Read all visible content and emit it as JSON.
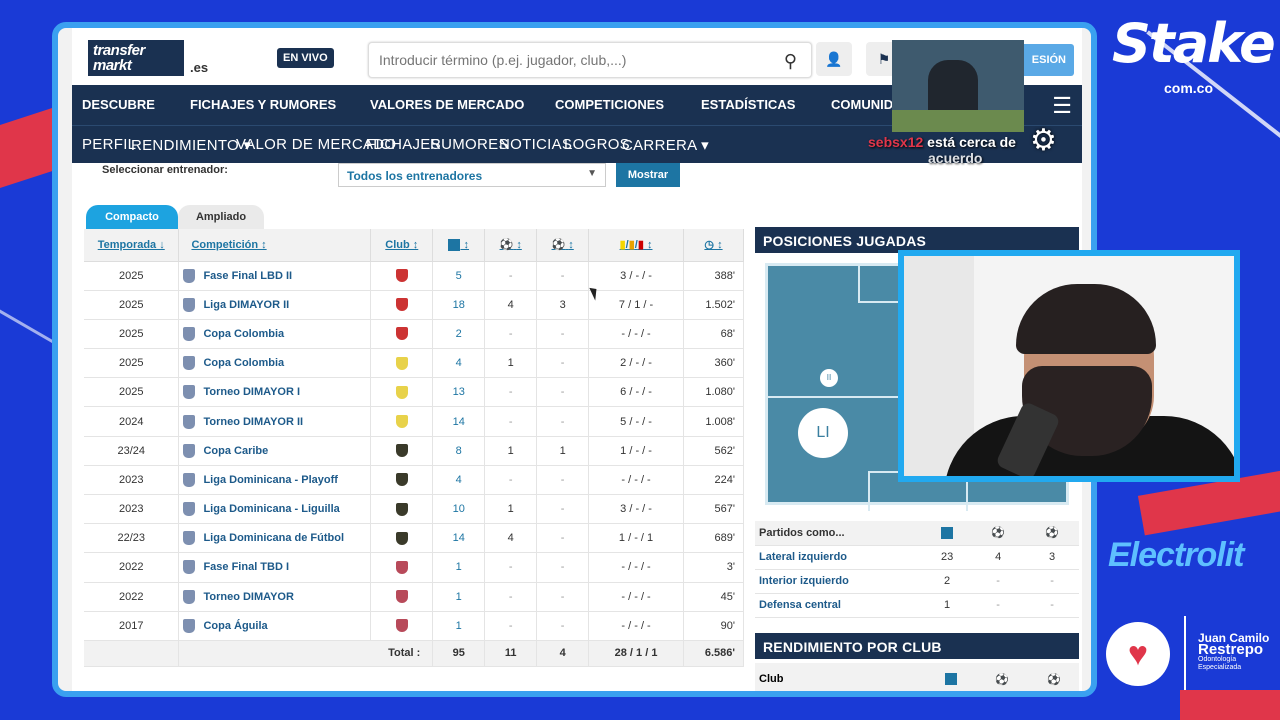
{
  "header": {
    "logo_text": "transfer markt",
    "logo_domain": ".es",
    "live_badge": "EN VIVO",
    "search_placeholder": "Introducir término (p.ej. jugador, club,...)",
    "login_label": "ESIÓN"
  },
  "nav_main": [
    "DESCUBRE",
    "FICHAJES Y RUMORES",
    "VALORES DE MERCADO",
    "COMPETICIONES",
    "ESTADÍSTICAS",
    "COMUNID"
  ],
  "nav_sub": [
    "PERFIL",
    "RENDIMIENTO ▾",
    "VALOR DE MERCADO",
    "FICHAJES",
    "RUMORES",
    "NOTICIAS",
    "LOGROS",
    "CARRERA ▾"
  ],
  "filter": {
    "label": "Seleccionar entrenador:",
    "value": "Todos los entrenadores",
    "button": "Mostrar"
  },
  "tabs": [
    "Compacto",
    "Ampliado"
  ],
  "table": {
    "headers": {
      "season": "Temporada ↓",
      "competition": "Competición ↕",
      "club": "Club ↕",
      "apps": "↕",
      "goals": "↕",
      "assists": "↕",
      "cards": "↕",
      "minutes": ""
    },
    "rows": [
      {
        "season": "2025",
        "competition": "Fase Final LBD II",
        "apps": "5",
        "goals": "-",
        "assists": "-",
        "cards": "3 / - / -",
        "minutes": "388'"
      },
      {
        "season": "2025",
        "competition": "Liga DIMAYOR II",
        "apps": "18",
        "goals": "4",
        "assists": "3",
        "cards": "7 / 1 / -",
        "minutes": "1.502'"
      },
      {
        "season": "2025",
        "competition": "Copa Colombia",
        "apps": "2",
        "goals": "-",
        "assists": "-",
        "cards": "- / - / -",
        "minutes": "68'"
      },
      {
        "season": "2025",
        "competition": "Copa Colombia",
        "apps": "4",
        "goals": "1",
        "assists": "-",
        "cards": "2 / - / -",
        "minutes": "360'"
      },
      {
        "season": "2025",
        "competition": "Torneo DIMAYOR I",
        "apps": "13",
        "goals": "-",
        "assists": "-",
        "cards": "6 / - / -",
        "minutes": "1.080'"
      },
      {
        "season": "2024",
        "competition": "Torneo DIMAYOR II",
        "apps": "14",
        "goals": "-",
        "assists": "-",
        "cards": "5 / - / -",
        "minutes": "1.008'"
      },
      {
        "season": "23/24",
        "competition": "Copa Caribe",
        "apps": "8",
        "goals": "1",
        "assists": "1",
        "cards": "1 / - / -",
        "minutes": "562'"
      },
      {
        "season": "2023",
        "competition": "Liga Dominicana - Playoff",
        "apps": "4",
        "goals": "-",
        "assists": "-",
        "cards": "- / - / -",
        "minutes": "224'"
      },
      {
        "season": "2023",
        "competition": "Liga Dominicana - Liguilla",
        "apps": "10",
        "goals": "1",
        "assists": "-",
        "cards": "3 / - / -",
        "minutes": "567'"
      },
      {
        "season": "22/23",
        "competition": "Liga Dominicana de Fútbol",
        "apps": "14",
        "goals": "4",
        "assists": "-",
        "cards": "1 / - / 1",
        "minutes": "689'"
      },
      {
        "season": "2022",
        "competition": "Fase Final TBD I",
        "apps": "1",
        "goals": "-",
        "assists": "-",
        "cards": "- / - / -",
        "minutes": "3'"
      },
      {
        "season": "2022",
        "competition": "Torneo DIMAYOR",
        "apps": "1",
        "goals": "-",
        "assists": "-",
        "cards": "- / - / -",
        "minutes": "45'"
      },
      {
        "season": "2017",
        "competition": "Copa Águila",
        "apps": "1",
        "goals": "-",
        "assists": "-",
        "cards": "- / - / -",
        "minutes": "90'"
      }
    ],
    "total": {
      "label": "Total :",
      "apps": "95",
      "goals": "11",
      "assists": "4",
      "cards": "28 / 1 / 1",
      "minutes": "6.586'"
    }
  },
  "positions": {
    "title": "POSICIONES JUGADAS",
    "main_marker": "LI",
    "second_marker": "II",
    "header": "Partidos como...",
    "rows": [
      {
        "label": "Lateral izquierdo",
        "apps": "23",
        "goals": "4",
        "assists": "3"
      },
      {
        "label": "Interior izquierdo",
        "apps": "2",
        "goals": "-",
        "assists": "-"
      },
      {
        "label": "Defensa central",
        "apps": "1",
        "goals": "-",
        "assists": "-"
      }
    ]
  },
  "club_perf": {
    "title": "RENDIMIENTO POR CLUB",
    "col": "Club"
  },
  "overlay": {
    "user": "sebsx12",
    "text": "está cerca de",
    "text2": "acuerdo"
  },
  "sponsors": {
    "stake": "Stake",
    "stake_domain": "com.co",
    "electrolit": "Electrolit",
    "name1": "Juan Camilo",
    "name2": "Restrepo",
    "sub1": "Odontología",
    "sub2": "Especializada"
  },
  "colors": {
    "navy": "#1a3151",
    "accent": "#1d75a3",
    "frame": "#3aa0f0",
    "bg": "#1a3ad6"
  }
}
